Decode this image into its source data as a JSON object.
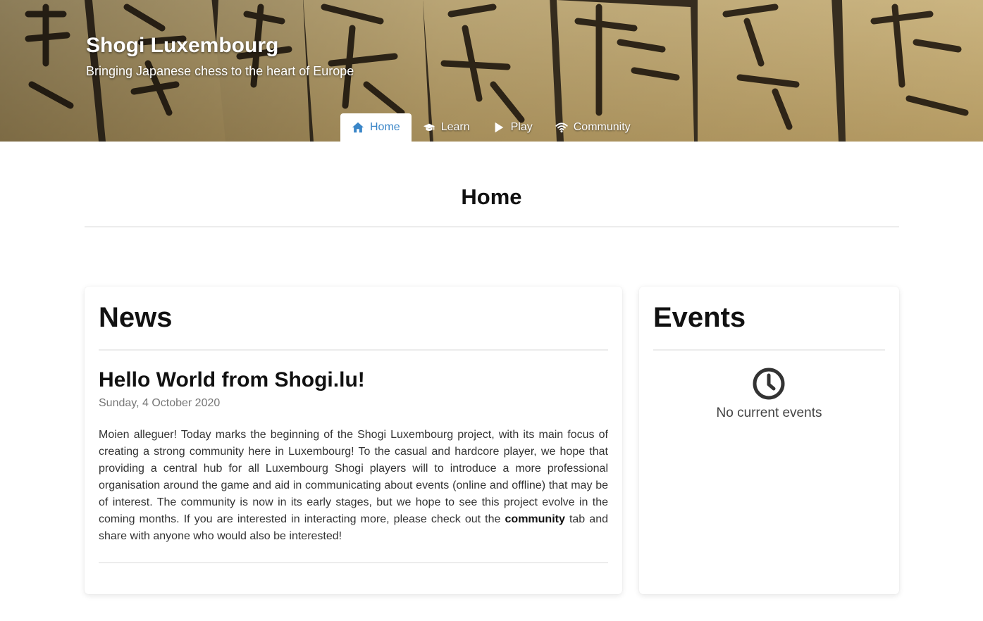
{
  "header": {
    "title": "Shogi Luxembourg",
    "subtitle": "Bringing Japanese chess to the heart of Europe"
  },
  "nav": {
    "tabs": [
      {
        "label": "Home",
        "icon": "home-icon",
        "active": true
      },
      {
        "label": "Learn",
        "icon": "graduation-cap-icon",
        "active": false
      },
      {
        "label": "Play",
        "icon": "play-icon",
        "active": false
      },
      {
        "label": "Community",
        "icon": "wifi-icon",
        "active": false
      }
    ]
  },
  "page": {
    "title": "Home"
  },
  "news": {
    "heading": "News",
    "post": {
      "title": "Hello World from Shogi.lu!",
      "date": "Sunday, 4 October 2020",
      "body_before": "Moien alleguer! Today marks the beginning of the Shogi Luxembourg project, with its main focus of creating a strong community here in Luxembourg! To the casual and hardcore player, we hope that providing a central hub for all Luxembourg Shogi players will to introduce a more professional organisation around the game and aid in communicating about events (online and offline) that may be of interest. The community is now in its early stages, but we hope to see this project evolve in the coming months. If you are interested in interacting more, please check out the ",
      "body_bold": "community",
      "body_after": " tab and share with anyone who would also be interested!"
    }
  },
  "events": {
    "heading": "Events",
    "icon": "clock-icon",
    "empty_text": "No current events"
  },
  "colors": {
    "accent": "#3a86c8",
    "rule": "#ececec",
    "muted_text": "#777777"
  }
}
